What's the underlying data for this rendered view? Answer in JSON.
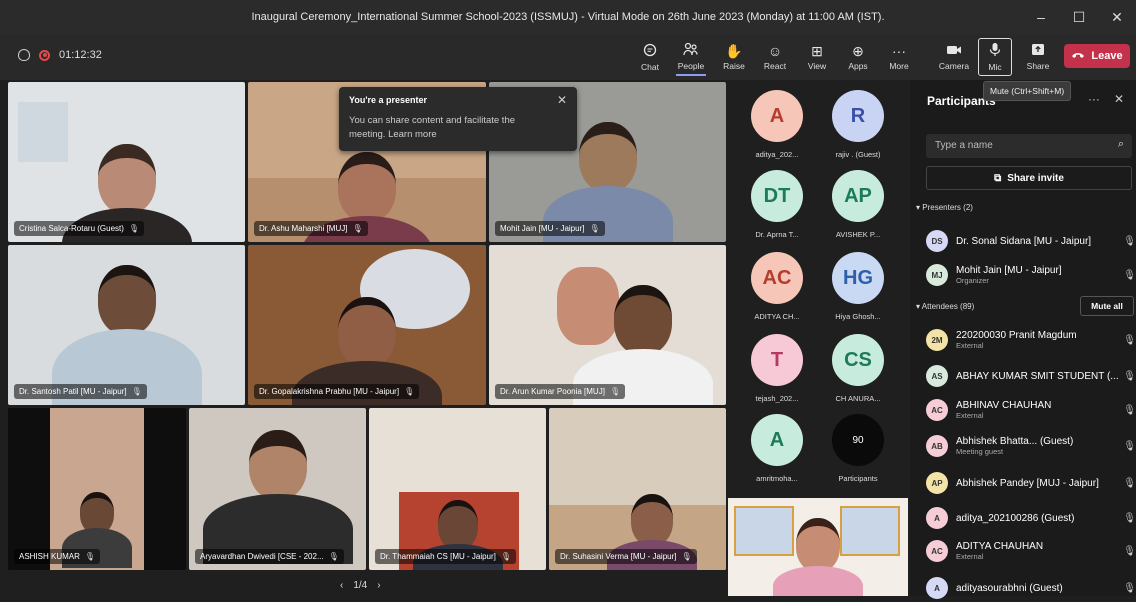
{
  "window": {
    "title": "Inaugural Ceremony_International Summer School-2023 (ISSMUJ) - Virtual Mode on 26th June 2023 (Monday) at 11:00 AM (IST).",
    "controls": [
      "–",
      "☐",
      "✕"
    ]
  },
  "meeting": {
    "elapsed": "01:12:32"
  },
  "toolbar": {
    "buttons": [
      {
        "label": "Chat",
        "icon": "chat-icon"
      },
      {
        "label": "People",
        "icon": "people-icon"
      },
      {
        "label": "Raise",
        "icon": "raise-hand-icon"
      },
      {
        "label": "React",
        "icon": "react-icon"
      },
      {
        "label": "View",
        "icon": "view-icon"
      },
      {
        "label": "Apps",
        "icon": "apps-icon"
      },
      {
        "label": "More",
        "icon": "more-icon"
      },
      {
        "label": "Camera",
        "icon": "camera-icon"
      },
      {
        "label": "Mic",
        "icon": "mic-icon"
      },
      {
        "label": "Share",
        "icon": "share-icon"
      }
    ],
    "leave_label": "Leave",
    "mic_tooltip": "Mute (Ctrl+Shift+M)"
  },
  "presenter_popup": {
    "title": "You're a presenter",
    "body": "You can share content and facilitate the meeting. Learn more"
  },
  "video_tiles": [
    {
      "name": "Cristina Salca-Rotaru (Guest)"
    },
    {
      "name": "Dr. Ashu Maharshi [MUJ]"
    },
    {
      "name": "Mohit Jain [MU - Jaipur]"
    },
    {
      "name": "Dr. Santosh Patil [MU - Jaipur]"
    },
    {
      "name": "Dr. Gopalakrishna Prabhu [MU - Jaipur]"
    },
    {
      "name": "Dr. Arun Kumar Poonia [MUJ]"
    },
    {
      "name": "ASHISH KUMAR"
    },
    {
      "name": "Aryavardhan Dwivedi [CSE - 202..."
    },
    {
      "name": "Dr. Thammaiah CS [MU - Jaipur]"
    },
    {
      "name": "Dr. Suhasini Verma [MU - Jaipur]"
    }
  ],
  "pager": {
    "text": "1/4"
  },
  "avatars": [
    {
      "initials": "A",
      "label": "aditya_202...",
      "color": "#f6c6b8",
      "text_color": "#b43d2e"
    },
    {
      "initials": "R",
      "label": "rajiv . (Guest)",
      "color": "#c9d3f3",
      "text_color": "#3a4fa8"
    },
    {
      "initials": "DT",
      "label": "Dr. Aprna T...",
      "color": "#c7ecdd",
      "text_color": "#1d7b58"
    },
    {
      "initials": "AP",
      "label": "AVISHEK P...",
      "color": "#c7ecdd",
      "text_color": "#1d7b58"
    },
    {
      "initials": "AC",
      "label": "ADITYA CH...",
      "color": "#f6c6b8",
      "text_color": "#b43d2e"
    },
    {
      "initials": "HG",
      "label": "Hiya Ghosh...",
      "color": "#c9d8f3",
      "text_color": "#2f5fa8"
    },
    {
      "initials": "T",
      "label": "tejash_202...",
      "color": "#f7c9d7",
      "text_color": "#b33a63"
    },
    {
      "initials": "CS",
      "label": "CH ANURA...",
      "color": "#c7ecdd",
      "text_color": "#1d7b58"
    },
    {
      "initials": "A",
      "label": "amritmoha...",
      "color": "#c7ecdd",
      "text_color": "#1d7b58"
    },
    {
      "initials": "90",
      "label": "Participants",
      "color": "#0a0a0a",
      "text_color": "#ffffff"
    }
  ],
  "participants_panel": {
    "title": "Participants",
    "search_placeholder": "Type a name",
    "share_invite": "Share invite",
    "presenters_header": "Presenters (2)",
    "attendees_header": "Attendees (89)",
    "mute_all": "Mute all",
    "presenters": [
      {
        "initials": "DS",
        "name": "Dr. Sonal Sidana [MU - Jaipur]",
        "sub": "",
        "color": "#d6d9f6"
      },
      {
        "initials": "MJ",
        "name": "Mohit Jain [MU - Jaipur]",
        "sub": "Organizer",
        "color": "#d7eadc"
      }
    ],
    "attendees": [
      {
        "initials": "2M",
        "name": "220200030 Pranit Magdum",
        "sub": "External",
        "color": "#f4e3a6"
      },
      {
        "initials": "AS",
        "name": "ABHAY KUMAR SMIT STUDENT (...",
        "sub": "",
        "color": "#d7eadc"
      },
      {
        "initials": "AC",
        "name": "ABHINAV CHAUHAN",
        "sub": "External",
        "color": "#f6cdd7"
      },
      {
        "initials": "AB",
        "name": "Abhishek Bhatta... (Guest)",
        "sub": "Meeting guest",
        "color": "#f6cdd7"
      },
      {
        "initials": "AP",
        "name": "Abhishek Pandey [MUJ - Jaipur]",
        "sub": "",
        "color": "#f4e3a6"
      },
      {
        "initials": "A",
        "name": "aditya_202100286 (Guest)",
        "sub": "",
        "color": "#f6cdd7"
      },
      {
        "initials": "AC",
        "name": "ADITYA CHAUHAN",
        "sub": "External",
        "color": "#f6cdd7"
      },
      {
        "initials": "A",
        "name": "adityasourabhni (Guest)",
        "sub": "",
        "color": "#d6d9f6"
      }
    ]
  },
  "colors": {
    "leave": "#c4314b",
    "accent": "#8b9af2"
  }
}
